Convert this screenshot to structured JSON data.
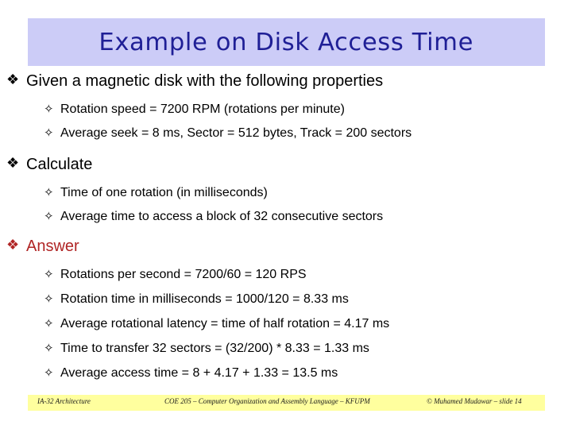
{
  "slide": {
    "title": "Example on Disk Access Time",
    "title_bg_color": "#ccccf7",
    "title_text_color": "#1f1f96",
    "answer_color": "#b02525",
    "footer_bg_color": "#ffff9e"
  },
  "sections": [
    {
      "heading": "Given a magnetic disk with the following properties",
      "bullet": "❖",
      "sub_bullet": "✧",
      "items": [
        "Rotation speed = 7200 RPM (rotations per minute)",
        "Average seek = 8 ms, Sector = 512 bytes, Track = 200 sectors"
      ]
    },
    {
      "heading": "Calculate",
      "bullet": "❖",
      "sub_bullet": "✧",
      "items": [
        "Time of one rotation (in milliseconds)",
        "Average time to access a block of 32 consecutive sectors"
      ]
    },
    {
      "heading": "Answer",
      "bullet": "❖",
      "sub_bullet": "✧",
      "items": [
        "Rotations per second  = 7200/60 = 120 RPS",
        "Rotation time in milliseconds = 1000/120 = 8.33 ms",
        "Average rotational latency = time of half rotation = 4.17 ms",
        "Time to transfer 32 sectors = (32/200) * 8.33 = 1.33 ms",
        "Average access time = 8 + 4.17 + 1.33 = 13.5 ms"
      ]
    }
  ],
  "footer": {
    "left": "IA-32 Architecture",
    "center": "COE 205 – Computer Organization and Assembly Language – KFUPM",
    "right": "© Muhamed Mudawar – slide 14"
  }
}
